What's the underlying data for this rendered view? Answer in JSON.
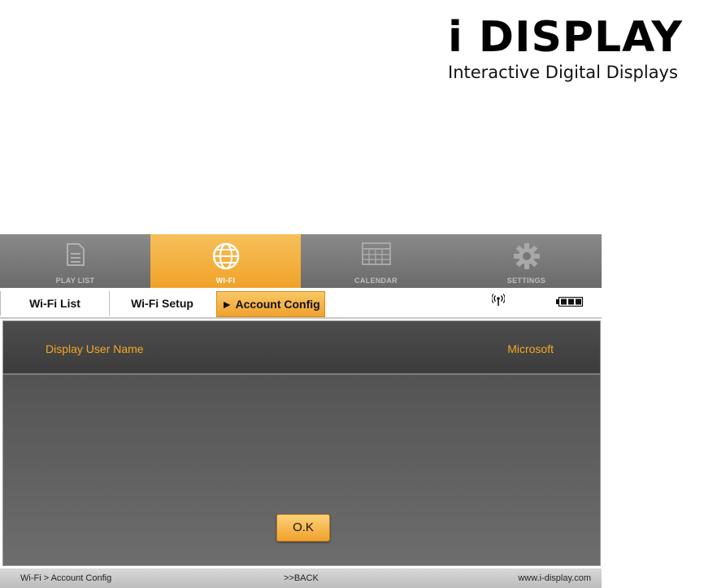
{
  "logo": {
    "title": "i DISPLAY",
    "subtitle": "Interactive Digital Displays"
  },
  "nav": {
    "items": [
      {
        "label": "PLAY LIST",
        "icon": "document-icon",
        "active": false
      },
      {
        "label": "WI-FI",
        "icon": "globe-icon",
        "active": true
      },
      {
        "label": "CALENDAR",
        "icon": "calendar-icon",
        "active": false
      },
      {
        "label": "SETTINGS",
        "icon": "gear-icon",
        "active": false
      }
    ]
  },
  "subtabs": [
    {
      "label": "Wi-Fi List"
    },
    {
      "label": "Wi-Fi Setup"
    },
    {
      "label": "► Account Config",
      "active": true
    }
  ],
  "status": {
    "wifi_icon": "wifi-signal-icon",
    "battery_icon": "battery-icon"
  },
  "content": {
    "label": "Display User Name",
    "value": "Microsoft",
    "ok_label": "O.K"
  },
  "footer": {
    "breadcrumb": "Wi-Fi > Account Config",
    "back": ">>BACK",
    "website": "www.i-display.com"
  },
  "colors": {
    "accent": "#f0a22a",
    "text_accent": "#f5a623"
  }
}
